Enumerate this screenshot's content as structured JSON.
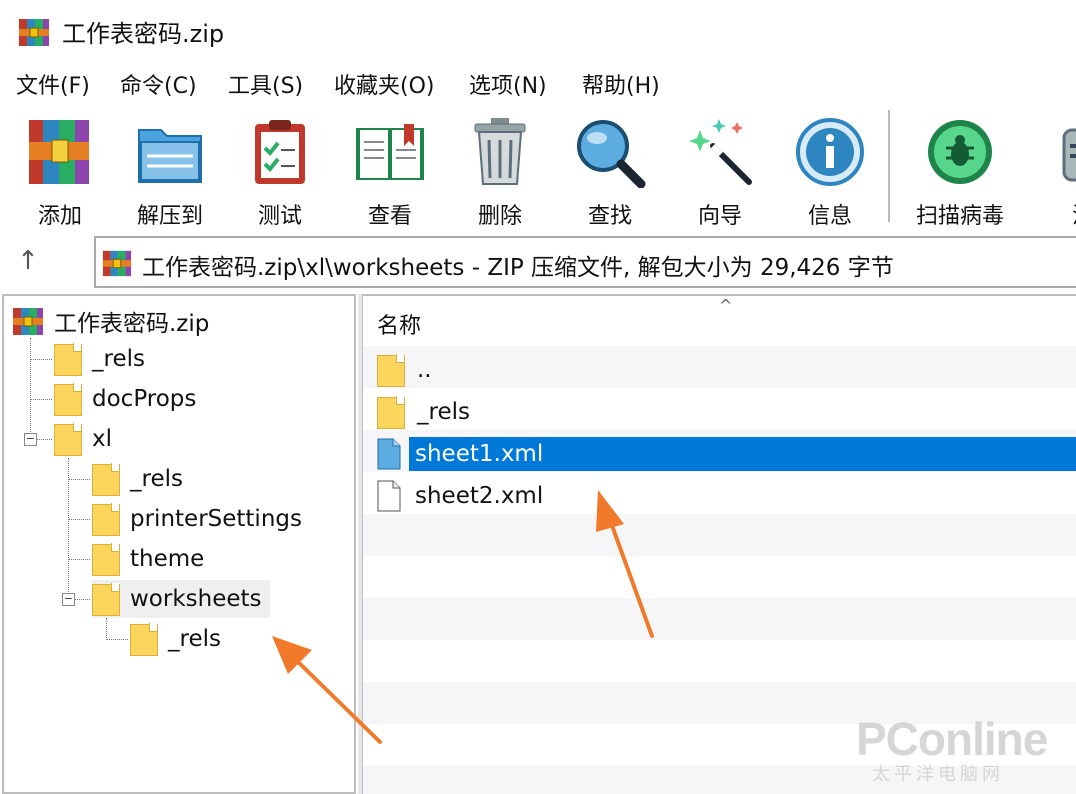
{
  "window": {
    "title": "工作表密码.zip"
  },
  "menu": [
    {
      "label": "文件(F)"
    },
    {
      "label": "命令(C)"
    },
    {
      "label": "工具(S)"
    },
    {
      "label": "收藏夹(O)"
    },
    {
      "label": "选项(N)"
    },
    {
      "label": "帮助(H)"
    }
  ],
  "toolbar": [
    {
      "label": "添加",
      "icon": "add-archive-icon"
    },
    {
      "label": "解压到",
      "icon": "extract-to-icon"
    },
    {
      "label": "测试",
      "icon": "test-icon"
    },
    {
      "label": "查看",
      "icon": "view-book-icon"
    },
    {
      "label": "删除",
      "icon": "delete-trash-icon"
    },
    {
      "label": "查找",
      "icon": "find-magnifier-icon"
    },
    {
      "label": "向导",
      "icon": "wizard-wand-icon"
    },
    {
      "label": "信息",
      "icon": "info-icon"
    },
    {
      "label": "扫描病毒",
      "icon": "virus-scan-icon"
    },
    {
      "label": "注",
      "icon": "comment-icon"
    }
  ],
  "address": {
    "text": "工作表密码.zip\\xl\\worksheets - ZIP 压缩文件, 解包大小为 29,426 字节"
  },
  "tree": {
    "root": "工作表密码.zip",
    "nodes": [
      "_rels",
      "docProps",
      "xl",
      "_rels",
      "printerSettings",
      "theme",
      "worksheets",
      "_rels"
    ]
  },
  "list": {
    "column_name": "名称",
    "rows": [
      {
        "name": "..",
        "type": "folder"
      },
      {
        "name": "_rels",
        "type": "folder"
      },
      {
        "name": "sheet1.xml",
        "type": "file",
        "selected": true
      },
      {
        "name": "sheet2.xml",
        "type": "file"
      }
    ]
  },
  "watermark": {
    "brand": "PConline",
    "sub": "太平洋电脑网"
  },
  "colors": {
    "selection": "#0078d7",
    "folder": "#fbd55c",
    "annotation_arrow": "#f07a2a"
  }
}
